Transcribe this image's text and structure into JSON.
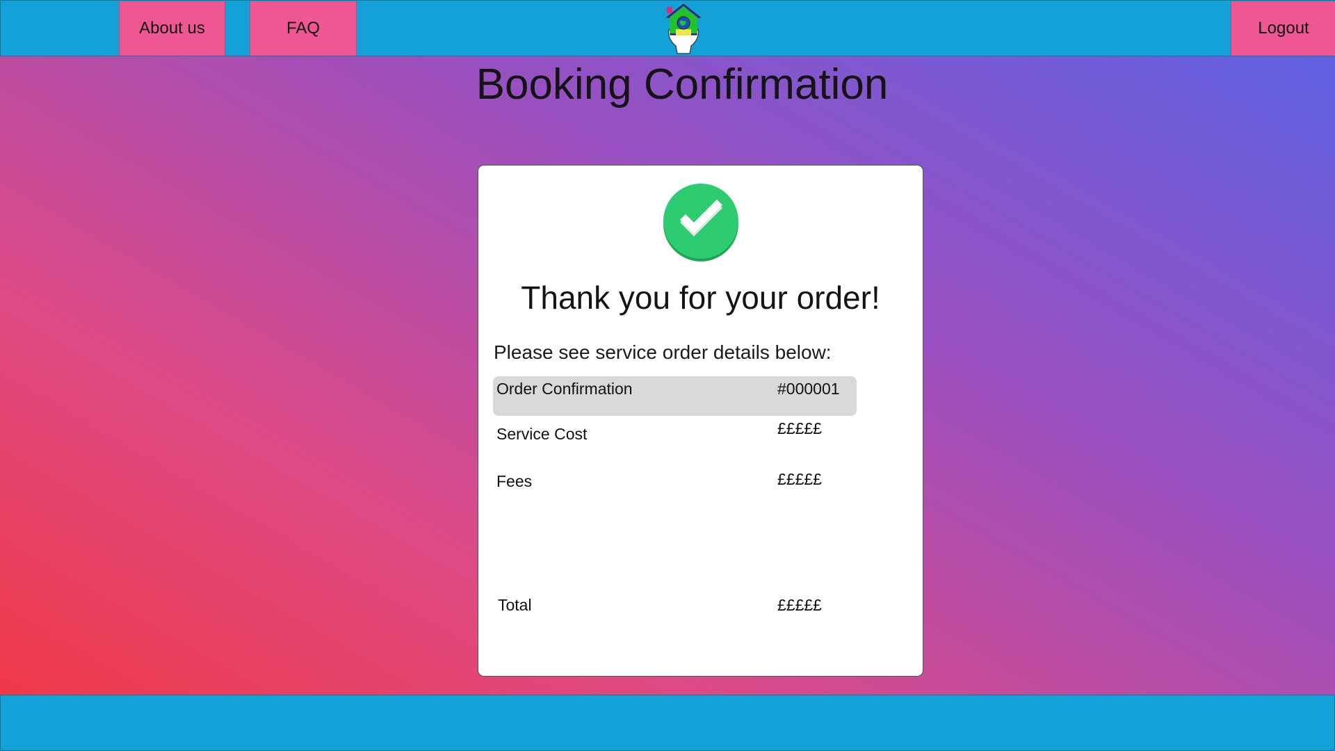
{
  "header": {
    "nav_about": "About us",
    "nav_faq": "FAQ",
    "nav_logout": "Logout",
    "logo_icon": "house-globe-hand-icon"
  },
  "page": {
    "title": "Booking Confirmation"
  },
  "confirmation": {
    "icon": "check-circle-icon",
    "thanks": "Thank you for your order!",
    "subtitle": "Please see service order details below:",
    "rows": [
      {
        "label": "Order Confirmation",
        "value": "#000001"
      },
      {
        "label": "Service Cost",
        "value": "£££££"
      },
      {
        "label": "Fees",
        "value": "£££££"
      },
      {
        "label": "Total",
        "value": "£££££"
      }
    ]
  },
  "colors": {
    "bar": "#14a1d8",
    "nav_button": "#ef5793",
    "success": "#2ecc71",
    "highlight_row": "#d9d9d9"
  }
}
